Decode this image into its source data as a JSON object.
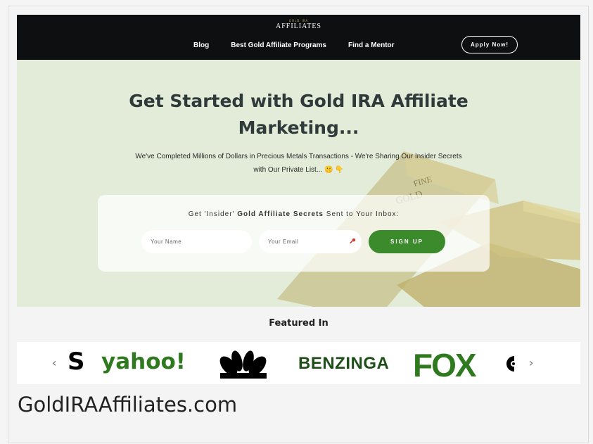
{
  "brand": {
    "small": "GOLD IRA",
    "main": "AFFILIATES"
  },
  "nav": {
    "links": [
      "Blog",
      "Best Gold Affiliate Programs",
      "Find a Mentor"
    ],
    "apply_label": "Apply Now!"
  },
  "hero": {
    "title_line1": "Get Started with Gold IRA Affiliate",
    "title_line2": "Marketing...",
    "subtitle_line1": "We've Completed Millions of Dollars in Precious Metals Transactions - We're Sharing Our Insider Secrets",
    "subtitle_line2": "with Our Private List... 🤫 👇"
  },
  "signup": {
    "title_pre": "Get 'Insider' ",
    "title_bold": "Gold Affiliate Secrets",
    "title_post": " Sent to Your Inbox:",
    "name_placeholder": "Your Name",
    "email_placeholder": "Your Email",
    "button_label": "SIGN UP"
  },
  "featured": {
    "heading": "Featured In",
    "logos": [
      "S",
      "yahoo!",
      "NBC",
      "BENZINGA",
      "FOX",
      "CBS"
    ]
  },
  "footer": {
    "domain": "GoldIRAAffiliates.com"
  },
  "colors": {
    "nav_bg": "#0e0f10",
    "hero_bg": "#e3ecd9",
    "accent_green": "#3b8a2b",
    "title": "#2f3a3a"
  }
}
